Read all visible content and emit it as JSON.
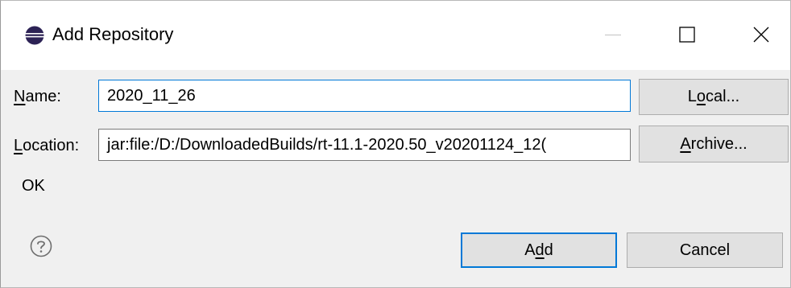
{
  "window": {
    "title": "Add Repository",
    "app_icon": "eclipse-icon",
    "controls": [
      "minimize",
      "maximize",
      "close"
    ]
  },
  "form": {
    "name_label_u": "N",
    "name_label_rest": "ame:",
    "name_value": "2020_11_26",
    "location_label_u": "L",
    "location_label_rest": "ocation:",
    "location_value": "jar:file:/D:/DownloadedBuilds/rt-11.1-2020.50_v20201124_12(",
    "local_button_pre": "L",
    "local_button_u": "o",
    "local_button_post": "cal...",
    "archive_button_u": "A",
    "archive_button_post": "rchive...",
    "status": "OK"
  },
  "footer": {
    "help_icon": "help-icon",
    "add_pre": "A",
    "add_u": "d",
    "add_post": "d",
    "cancel_label": "Cancel"
  },
  "colors": {
    "accent": "#0078d7",
    "dialog_bg": "#f0f0f0",
    "button_bg": "#e1e1e1"
  }
}
